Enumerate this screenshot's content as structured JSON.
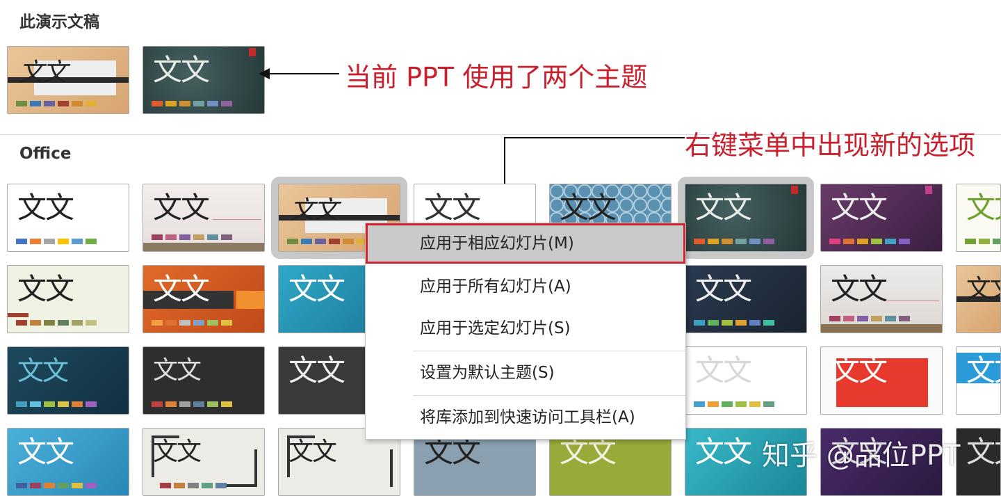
{
  "sections": {
    "this_presentation": "此演示文稿",
    "office": "Office"
  },
  "annotations": {
    "two_themes": "当前 PPT 使用了两个主题",
    "new_options": "右键菜单中出现新的选项"
  },
  "context_menu": {
    "items": [
      {
        "label": "应用于相应幻灯片(M)",
        "highlighted": true
      },
      {
        "label": "应用于所有幻灯片(A)"
      },
      {
        "label": "应用于选定幻灯片(S)"
      },
      {
        "label": "设置为默认主题(S)"
      },
      {
        "label": "将库添加到快速访问工具栏(A)"
      }
    ]
  },
  "theme_glyph": "文文",
  "watermark": "知乎 @品位PPT",
  "colors": {
    "annotation_red": "#c8202c",
    "menu_highlight": "#c9c9c9",
    "highlight_border": "#d0232e"
  }
}
